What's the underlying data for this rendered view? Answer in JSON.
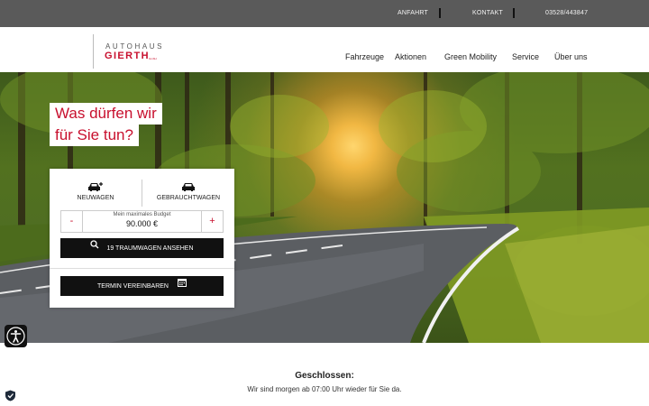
{
  "topbar": {
    "links": [
      {
        "label": "ANFAHRT"
      },
      {
        "label": "KONTAKT"
      },
      {
        "label": "03528/443847"
      }
    ]
  },
  "header": {
    "logo": {
      "line1": "AUTOHAUS",
      "line2": "GIERTH",
      "small": "GmbH"
    },
    "nav": [
      {
        "label": "Fahrzeuge"
      },
      {
        "label": "Aktionen"
      },
      {
        "label": "Green Mobility"
      },
      {
        "label": "Service"
      },
      {
        "label": "Über uns"
      }
    ]
  },
  "hero": {
    "headline_line1": "Was dürfen wir",
    "headline_line2": "für Sie tun?"
  },
  "search_card": {
    "tabs": [
      {
        "label": "NEUWAGEN",
        "icon": "new-car-icon"
      },
      {
        "label": "GEBRAUCHTWAGEN",
        "icon": "used-car-icon"
      }
    ],
    "budget": {
      "label": "Mein maximales Budget",
      "value": "90.000 €",
      "minus": "-",
      "plus": "+"
    },
    "search_button": "19 TRAUMWAGEN ANSEHEN",
    "appointment_button": "TERMIN VEREINBAREN"
  },
  "status": {
    "title": "Geschlossen:",
    "text": "Wir sind morgen ab 07:00 Uhr wieder für Sie da."
  },
  "colors": {
    "brand_red": "#c8102e",
    "topbar": "#5a5a5a",
    "button": "#111111"
  }
}
